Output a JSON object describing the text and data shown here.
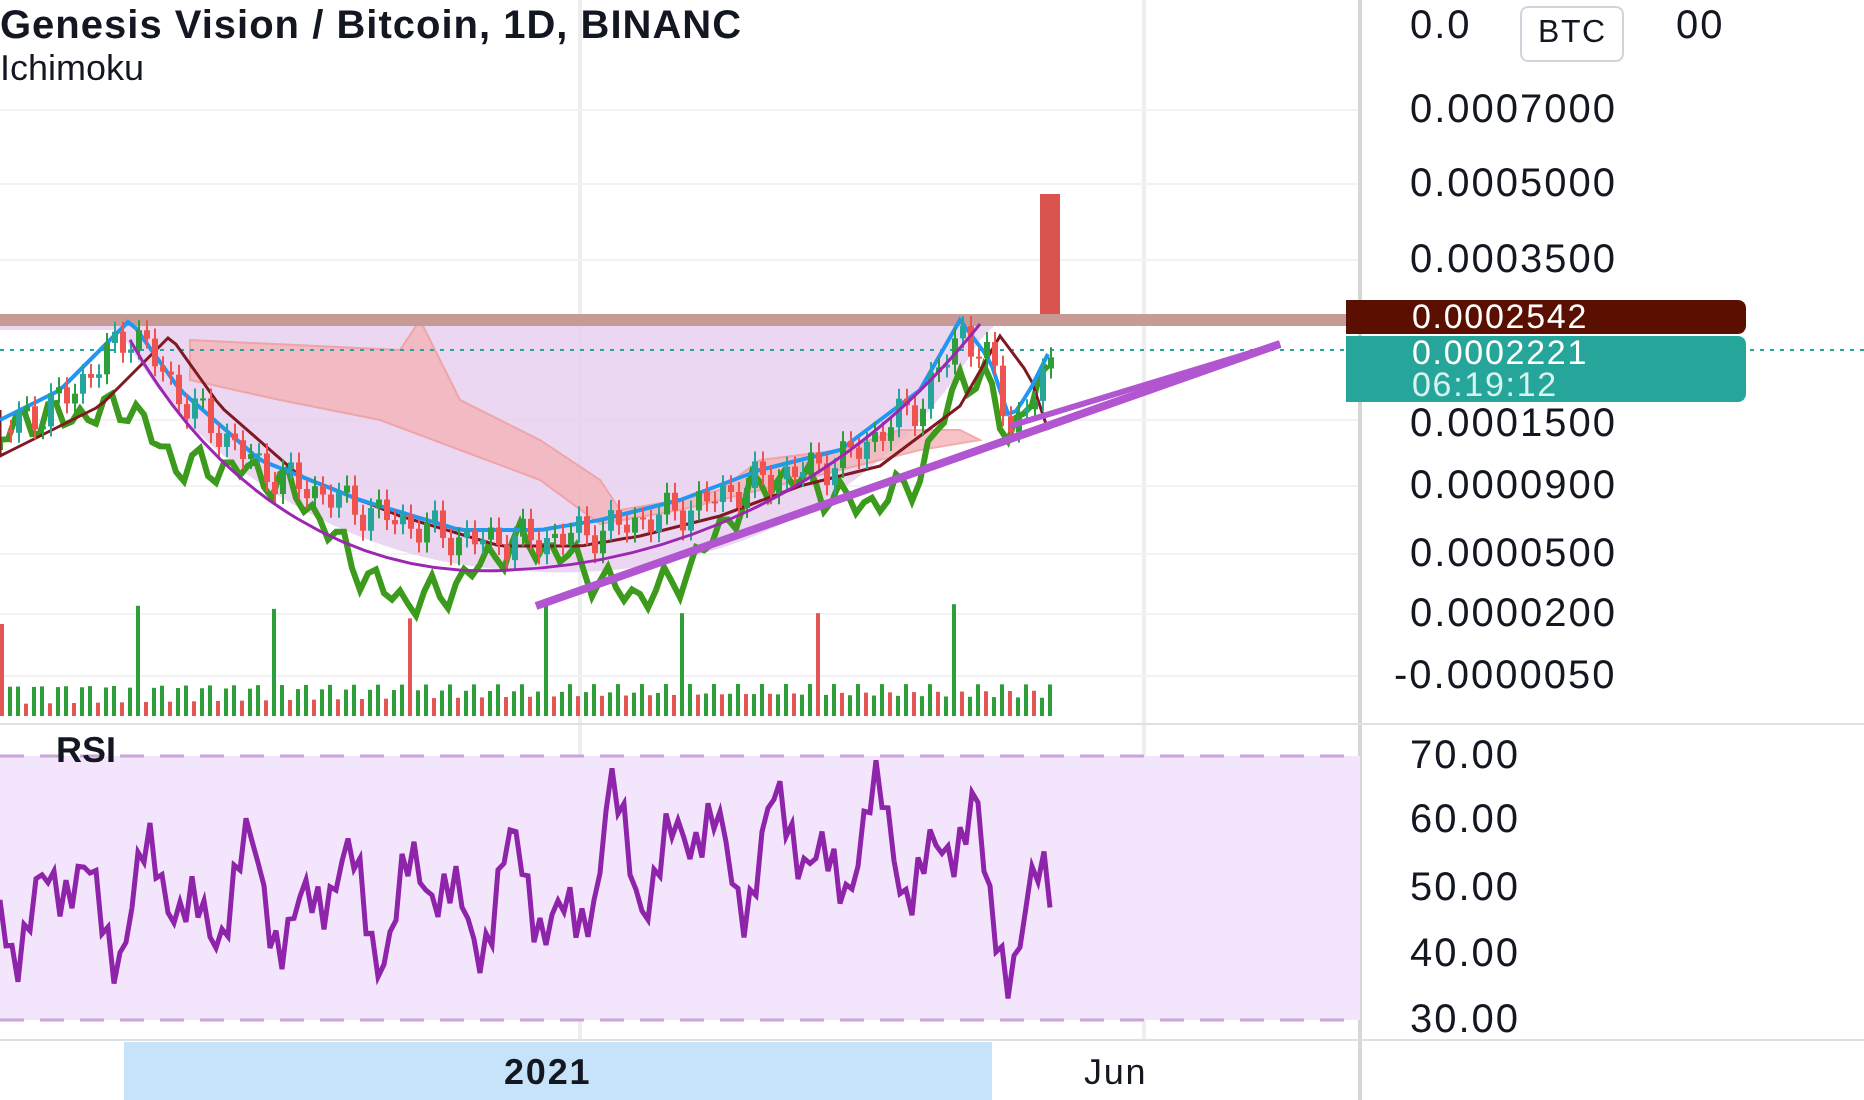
{
  "legend": {
    "title": "Genesis Vision / Bitcoin, 1D, BINANC",
    "indicator": "Ichimoku"
  },
  "currency_badge": "BTC",
  "price_axis": {
    "top_label_parts": [
      "0.0",
      "00"
    ],
    "labels": [
      "0.0007000",
      "0.0005000",
      "0.0003500",
      "0.0001500",
      "0.0000900",
      "0.0000500",
      "0.0000200",
      "-0.0000050"
    ]
  },
  "price_tags": [
    {
      "price": "0.0002542",
      "color": "#5b0f00"
    },
    {
      "price": "0.0002221",
      "countdown": "06:19:12",
      "color": "#26a69a"
    }
  ],
  "rsi": {
    "label": "RSI",
    "axis": [
      "70.00",
      "60.00",
      "50.00",
      "40.00",
      "30.00"
    ]
  },
  "time_axis": [
    {
      "label": "2021",
      "selected": true
    },
    {
      "label": "Jun",
      "selected": false
    }
  ]
}
